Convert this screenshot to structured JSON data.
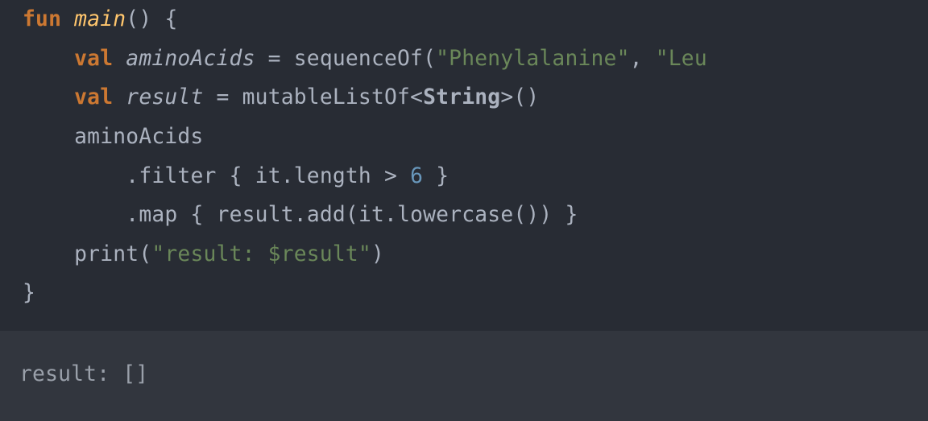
{
  "code": {
    "kw_fun": "fun",
    "fn_main": "main",
    "oparen": "(",
    "cparen": ")",
    "obrace": "{",
    "cbrace": "}",
    "indent1": "    ",
    "indent2": "        ",
    "kw_val": "val",
    "sp": " ",
    "aminoAcids_decl": "aminoAcids",
    "eq": "=",
    "sequenceOf": "sequenceOf",
    "str_pheny": "\"Phenylalanine\"",
    "comma": ",",
    "str_leu_cut": "\"Leu",
    "result_decl": "result",
    "mutableListOf": "mutableListOf",
    "lt": "<",
    "String": "String",
    "gt": ">",
    "aminoAcids_use": "aminoAcids",
    "dot": ".",
    "filter": "filter",
    "lcurly": "{",
    "rcurly": "}",
    "it_length": "it.length",
    "gt_op": ">",
    "six": "6",
    "map": "map",
    "result_use": "result",
    "add": "add",
    "it_lowercase": "it.lowercase()",
    "print": "print",
    "str_result_prefix": "\"result: ",
    "tmpl_result": "$result",
    "str_close_quote": "\""
  },
  "output": {
    "text": "result: []"
  }
}
